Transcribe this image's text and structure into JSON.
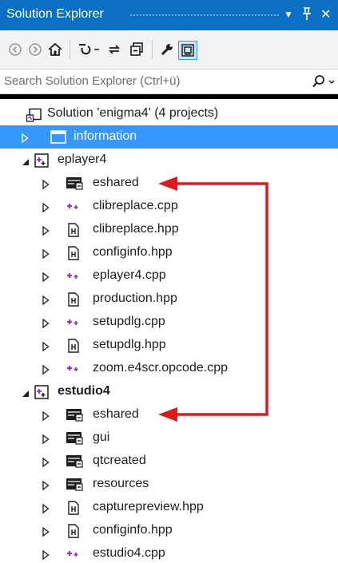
{
  "window": {
    "title": "Solution Explorer",
    "controls": [
      "▼",
      "ᚬ",
      "✕"
    ]
  },
  "search": {
    "placeholder": "Search Solution Explorer (Ctrl+ü)"
  },
  "solution": {
    "label": "Solution 'enigma4' (4 projects)"
  },
  "rows": [
    {
      "label": "information"
    },
    {
      "label": "eplayer4"
    },
    {
      "label": "eshared"
    },
    {
      "label": "clibreplace.cpp"
    },
    {
      "label": "clibreplace.hpp"
    },
    {
      "label": "configinfo.hpp"
    },
    {
      "label": "eplayer4.cpp"
    },
    {
      "label": "production.hpp"
    },
    {
      "label": "setupdlg.cpp"
    },
    {
      "label": "setupdlg.hpp"
    },
    {
      "label": "zoom.e4scr.opcode.cpp"
    },
    {
      "label": "estudio4"
    },
    {
      "label": "eshared"
    },
    {
      "label": "gui"
    },
    {
      "label": "qtcreated"
    },
    {
      "label": "resources"
    },
    {
      "label": "capturepreview.hpp"
    },
    {
      "label": "configinfo.hpp"
    },
    {
      "label": "estudio4.cpp"
    }
  ],
  "colors": {
    "accent": "#3399ff",
    "titlebar": "#0b70c4",
    "annotation_arrow": "#e0191b",
    "cpp_icon": "#8b3fb0"
  }
}
